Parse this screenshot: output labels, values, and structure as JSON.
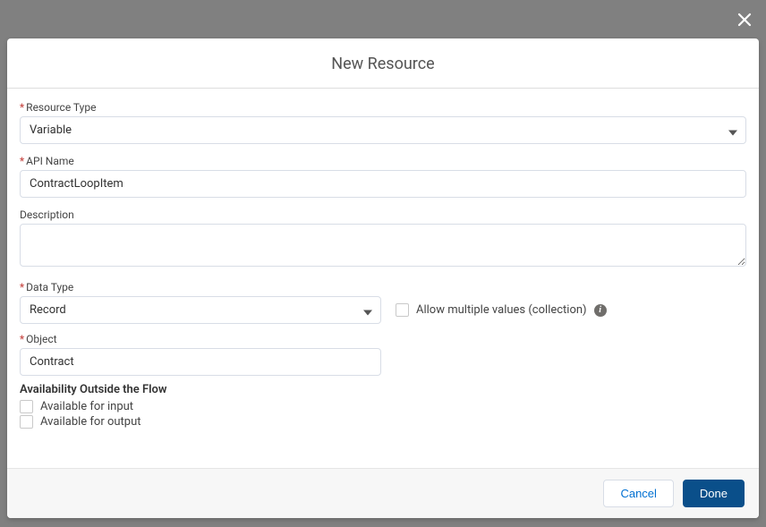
{
  "header": {
    "title": "New Resource"
  },
  "fields": {
    "resourceType": {
      "label": "Resource Type",
      "value": "Variable"
    },
    "apiName": {
      "label": "API Name",
      "value": "ContractLoopItem"
    },
    "description": {
      "label": "Description",
      "value": ""
    },
    "dataType": {
      "label": "Data Type",
      "value": "Record"
    },
    "allowMultiple": {
      "label": "Allow multiple values (collection)"
    },
    "object": {
      "label": "Object",
      "value": "Contract"
    },
    "availabilityHeading": "Availability Outside the Flow",
    "availableInput": {
      "label": "Available for input"
    },
    "availableOutput": {
      "label": "Available for output"
    }
  },
  "footer": {
    "cancel": "Cancel",
    "done": "Done"
  }
}
